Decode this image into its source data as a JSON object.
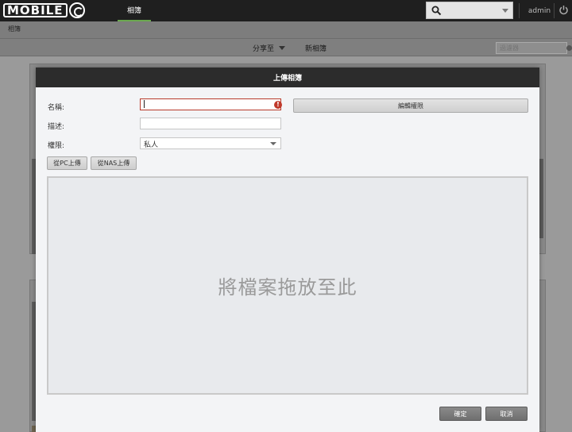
{
  "topbar": {
    "logo_text": "MOBILE",
    "nav_album": "相簿",
    "user": "admin"
  },
  "breadcrumb": "相簿",
  "toolbar": {
    "share_label": "分享至",
    "new_album_label": "新相簿",
    "filter_placeholder": "過濾器"
  },
  "modal": {
    "title": "上傳相簿",
    "name_label": "名稱:",
    "desc_label": "描述:",
    "perm_label": "權限:",
    "perm_value": "私人",
    "edit_perm_button": "編輯權限",
    "upload_pc_button": "從PC上傳",
    "upload_nas_button": "從NAS上傳",
    "dropzone_text": "將檔案拖放至此",
    "ok_button": "確定",
    "cancel_button": "取消"
  },
  "colors": {
    "accent_green": "#6aa84f",
    "error_red": "#b73a2a",
    "header_dark": "#2c2c2c"
  }
}
